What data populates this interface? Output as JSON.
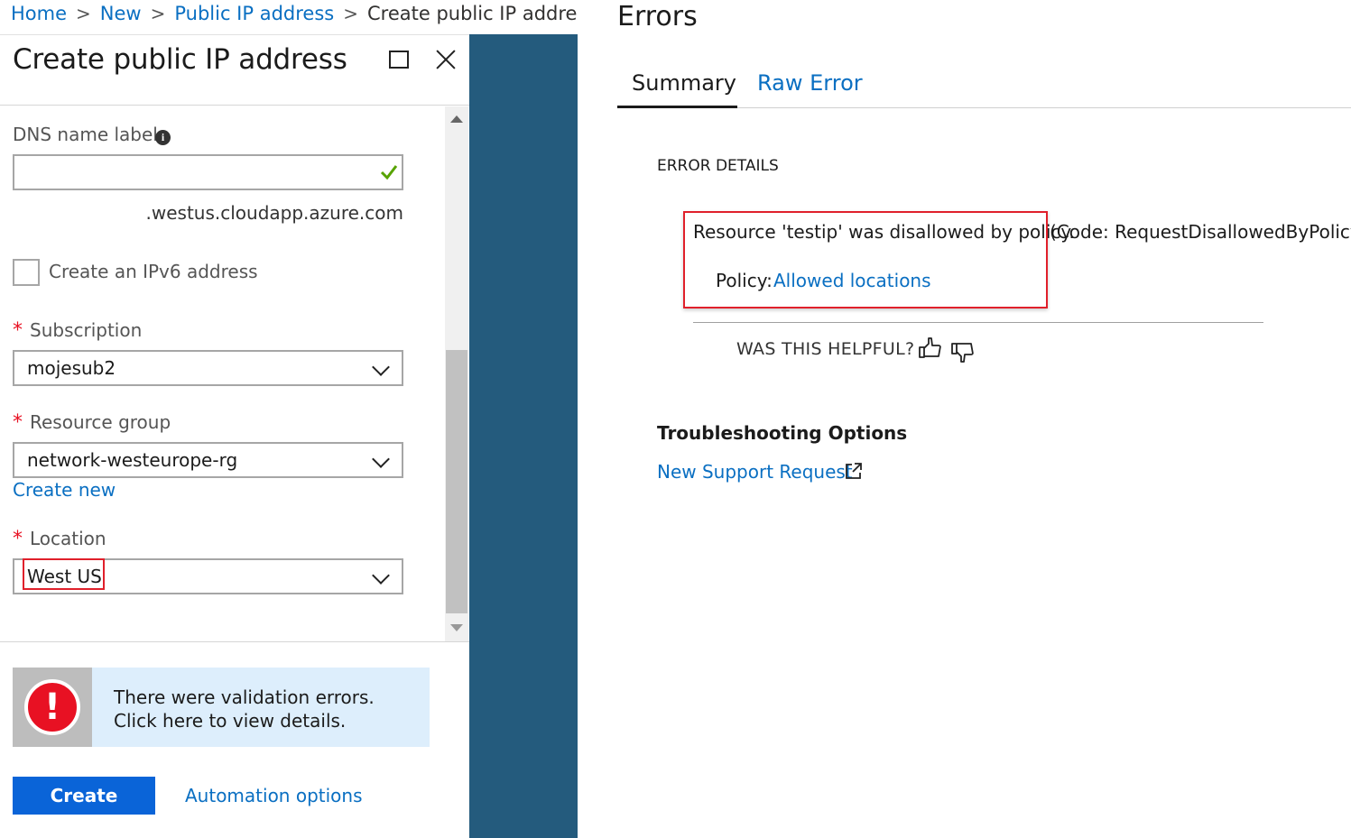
{
  "breadcrumb": {
    "items": [
      "Home",
      "New",
      "Public IP address"
    ],
    "current": "Create public IP address"
  },
  "blade": {
    "title": "Create public IP address",
    "dns": {
      "label": "DNS name label",
      "value": "",
      "suffix": ".westus.cloudapp.azure.com"
    },
    "ipv6": {
      "label": "Create an IPv6 address",
      "checked": false
    },
    "subscription": {
      "label": "Subscription",
      "value": "mojesub2"
    },
    "resource_group": {
      "label": "Resource group",
      "value": "network-westeurope-rg",
      "create_new": "Create new"
    },
    "location": {
      "label": "Location",
      "value": "West US"
    },
    "validation": {
      "icon": "!",
      "message": "There were validation errors. Click here to view details."
    },
    "create_button": "Create",
    "automation_link": "Automation options",
    "required_marker": "*"
  },
  "errors": {
    "title": "Errors",
    "tabs": [
      "Summary",
      "Raw Error"
    ],
    "details_heading": "ERROR DETAILS",
    "message": "Resource 'testip' was disallowed by policy.",
    "code": "(Code: RequestDisallowedByPolicy)",
    "policy_label": "Policy:",
    "policy_link": "Allowed locations",
    "helpful": "WAS THIS HELPFUL?",
    "troubleshooting_heading": "Troubleshooting Options",
    "support_link": "New Support Request"
  },
  "colors": {
    "accent": "#0a6fc2",
    "button": "#0a64d8",
    "error": "#e81123",
    "panel_gap": "#245b7d",
    "validation_bg": "#ddeefc"
  },
  "icons": [
    "info-icon",
    "check-icon",
    "chevron-down-icon",
    "maximize-icon",
    "close-icon",
    "error-icon",
    "thumbs-up-icon",
    "thumbs-down-icon",
    "external-link-icon"
  ]
}
